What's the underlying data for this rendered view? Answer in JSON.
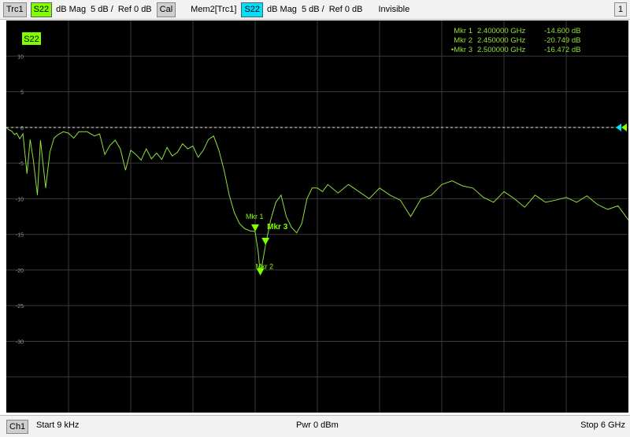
{
  "toolbar": {
    "trace_label": "Trc1",
    "trace_param": "S22",
    "trace_format": "dB Mag",
    "trace_scale": "5 dB /",
    "trace_ref": "Ref 0 dB",
    "cal_label": "Cal",
    "mem_label": "Mem2[Trc1]",
    "mem_param": "S22",
    "mem_format": "dB Mag",
    "mem_scale": "5 dB /",
    "mem_ref": "Ref 0 dB",
    "mem_state": "Invisible",
    "window_number": "1"
  },
  "chart_data": {
    "type": "line",
    "trace_tag": "S22",
    "xlim": [
      9e-06,
      6.0
    ],
    "ylim": [
      -40,
      15
    ],
    "y_ticks": [
      10,
      5,
      0,
      -5,
      -10,
      -15,
      -20,
      -25,
      -30
    ],
    "y_tick_labels": [
      "10",
      "5",
      "0",
      "-5",
      "-10",
      "-15",
      "-20",
      "-25",
      "-30"
    ],
    "ref_level": 0,
    "grid": true,
    "trace_color": "#8ee03a",
    "series": [
      {
        "x": [
          9e-06,
          0.02,
          0.05,
          0.08,
          0.1,
          0.13,
          0.16,
          0.2,
          0.23,
          0.26,
          0.3,
          0.33,
          0.38,
          0.42,
          0.46,
          0.5,
          0.55,
          0.6,
          0.65,
          0.7,
          0.78,
          0.85,
          0.9,
          0.95,
          1.0,
          1.05,
          1.1,
          1.15,
          1.2,
          1.25,
          1.3,
          1.35,
          1.4,
          1.45,
          1.5,
          1.55,
          1.6,
          1.65,
          1.7,
          1.75,
          1.8,
          1.85,
          1.9,
          1.95,
          2.0,
          2.05,
          2.1,
          2.15,
          2.2,
          2.25,
          2.3,
          2.35,
          2.4,
          2.43,
          2.45,
          2.47,
          2.5,
          2.55,
          2.6,
          2.65,
          2.7,
          2.75,
          2.8,
          2.85,
          2.9,
          2.95,
          3.0,
          3.05,
          3.1,
          3.2,
          3.3,
          3.4,
          3.5,
          3.6,
          3.7,
          3.8,
          3.9,
          4.0,
          4.1,
          4.2,
          4.3,
          4.4,
          4.5,
          4.6,
          4.7,
          4.8,
          4.9,
          5.0,
          5.1,
          5.2,
          5.3,
          5.4,
          5.5,
          5.6,
          5.7,
          5.8,
          5.9,
          6.0
        ],
        "y": [
          0,
          -0.3,
          -0.5,
          -1.0,
          -0.8,
          -1.6,
          -0.9,
          -6.5,
          -1.7,
          -4.5,
          -9.5,
          -1.8,
          -8.5,
          -3.5,
          -1.5,
          -1.0,
          -0.6,
          -0.8,
          -1.5,
          -0.6,
          -0.6,
          -1.2,
          -0.9,
          -3.8,
          -2.5,
          -1.8,
          -3.0,
          -6.0,
          -3.2,
          -3.8,
          -4.6,
          -3.0,
          -4.4,
          -3.6,
          -4.5,
          -2.8,
          -4.0,
          -3.5,
          -2.3,
          -3.0,
          -2.6,
          -4.2,
          -3.2,
          -1.7,
          -1.2,
          -3.2,
          -6.0,
          -9.5,
          -12.0,
          -13.5,
          -14.2,
          -14.5,
          -14.6,
          -17.5,
          -20.7,
          -19.0,
          -16.5,
          -13.0,
          -10.5,
          -9.5,
          -12.5,
          -14.0,
          -14.8,
          -13.5,
          -10.0,
          -8.5,
          -8.5,
          -9.0,
          -8.0,
          -9.2,
          -8.0,
          -9.0,
          -10.0,
          -8.5,
          -9.5,
          -10.2,
          -12.5,
          -10.0,
          -9.5,
          -8.0,
          -7.5,
          -8.2,
          -8.5,
          -9.8,
          -10.5,
          -9.0,
          -10.0,
          -11.2,
          -9.5,
          -10.5,
          -10.2,
          -9.8,
          -10.5,
          -9.6,
          -10.8,
          -11.5,
          -11.0,
          -13.0
        ]
      }
    ],
    "markers": [
      {
        "label": "Mkr 1",
        "freq_text": "2.400000 GHz",
        "value_text": "-14.600 dB",
        "x": 2.4,
        "y": -14.6,
        "active": false
      },
      {
        "label": "Mkr 2",
        "freq_text": "2.450000 GHz",
        "value_text": "-20.749 dB",
        "x": 2.45,
        "y": -20.749,
        "active": false
      },
      {
        "label": "Mkr 3",
        "freq_text": "2.500000 GHz",
        "value_text": "-16.472 dB",
        "x": 2.5,
        "y": -16.472,
        "active": true
      }
    ],
    "marker_table_color": "#8ee03a",
    "ref_arrow_colors": [
      "#00e0ff",
      "#7fff00"
    ]
  },
  "status": {
    "channel": "Ch1",
    "start": "Start  9 kHz",
    "power": "Pwr  0 dBm",
    "stop": "Stop  6 GHz"
  }
}
